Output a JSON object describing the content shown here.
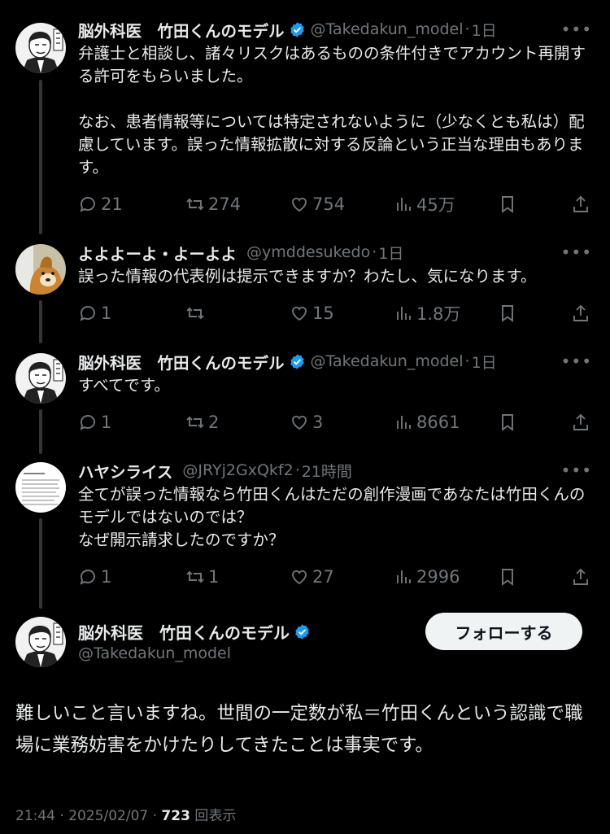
{
  "tweets": [
    {
      "name": "脳外科医　竹田くんのモデル",
      "verified": true,
      "handle": "@Takedakun_model",
      "time": "1日",
      "text": "弁護士と相談し、諸々リスクはあるものの条件付きでアカウント再開する許可をもらいました。\n\nなお、患者情報等については特定されないように（少なくとも私は）配慮しています。誤った情報拡散に対する反論という正当な理由もあります。",
      "replies": "21",
      "retweets": "274",
      "likes": "754",
      "views": "45万"
    },
    {
      "name": "よよよーよ・よーよよ",
      "verified": false,
      "handle": "@ymddesukedo",
      "time": "1日",
      "text": "誤った情報の代表例は提示できますか？わたし、気になります。",
      "replies": "1",
      "retweets": "",
      "likes": "15",
      "views": "1.8万"
    },
    {
      "name": "脳外科医　竹田くんのモデル",
      "verified": true,
      "handle": "@Takedakun_model",
      "time": "1日",
      "text": "すべてです。",
      "replies": "1",
      "retweets": "2",
      "likes": "3",
      "views": "8661"
    },
    {
      "name": "ハヤシライス",
      "verified": false,
      "handle": "@JRYj2GxQkf2",
      "time": "21時間",
      "text": "全てが誤った情報なら竹田くんはただの創作漫画であなたは竹田くんのモデルではないのでは？\nなぜ開示請求したのですか？",
      "replies": "1",
      "retweets": "1",
      "likes": "27",
      "views": "2996"
    }
  ],
  "main": {
    "name": "脳外科医　竹田くんのモデル",
    "handle": "@Takedakun_model",
    "follow_label": "フォローする",
    "text": "難しいこと言いますね。世間の一定数が私＝竹田くんという認識で職場に業務妨害をかけたりしてきたことは事実です。",
    "time": "21:44",
    "date": "2025/02/07",
    "views_count": "723",
    "views_label": "回表示"
  },
  "colors": {
    "background": "#000000",
    "text": "#e7e9ea",
    "secondary": "#71767b",
    "verified": "#1d9bf0"
  }
}
